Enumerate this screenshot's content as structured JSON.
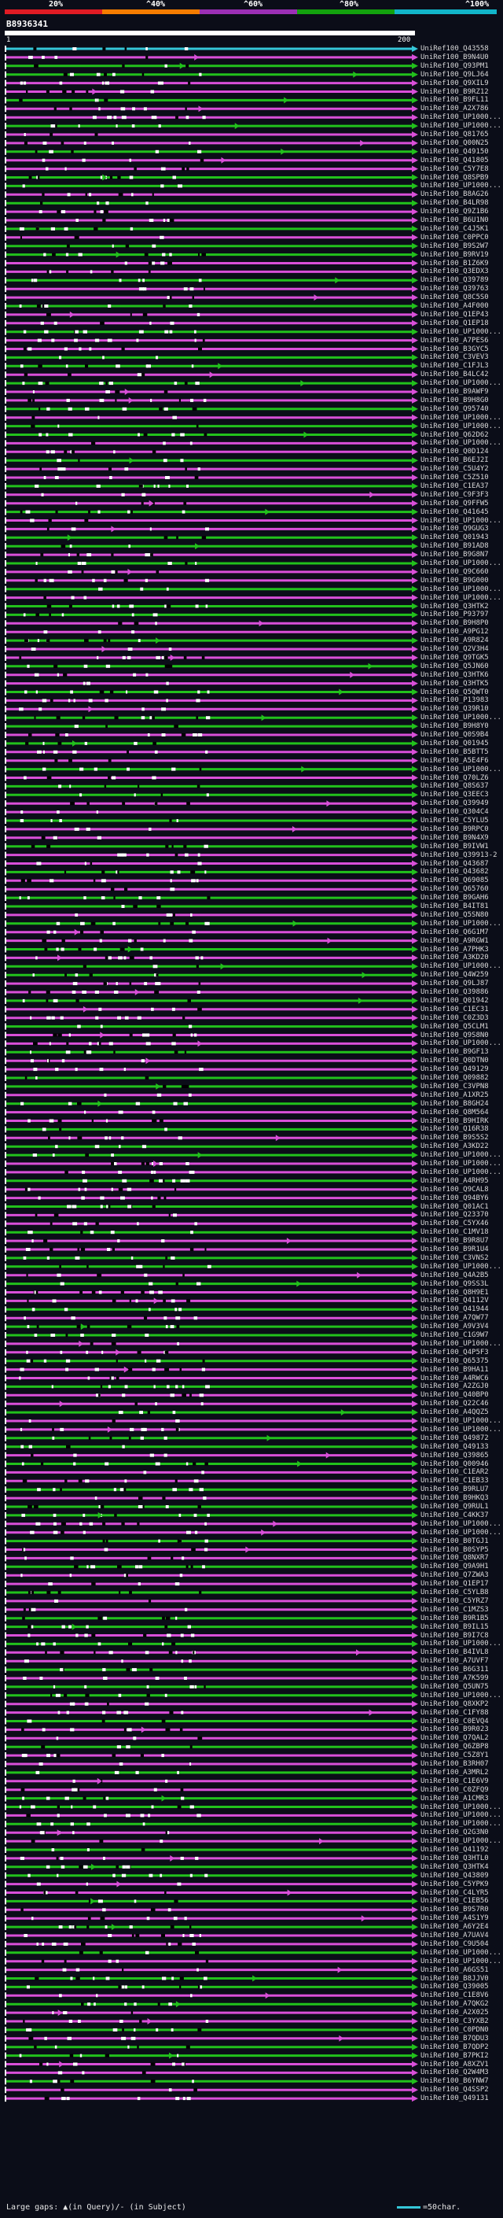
{
  "header": {
    "query_id": "B8936341",
    "start": "1",
    "end": "200",
    "scale_labels": [
      "20%",
      "^40%",
      "^60%",
      "^80%",
      "^100%"
    ],
    "scale_colors": [
      "#e01b24",
      "#f57c00",
      "#9b2fb5",
      "#13a10e",
      "#12b5c9"
    ]
  },
  "colors": {
    "green": "#22c11c",
    "magenta": "#d94fd9",
    "cyan": "#35c6d8",
    "white": "#ffffff",
    "black": "#000000"
  },
  "hits": [
    "UniRef100_Q43558",
    "UniRef100_B9N4U0",
    "UniRef100_Q93PM1",
    "UniRef100_Q9LJ64",
    "UniRef100_Q9XIL9",
    "UniRef100_B9RZ12",
    "UniRef100_B9FL11",
    "UniRef100_A2X786",
    "UniRef100_UP1000...",
    "UniRef100_UP1000...",
    "UniRef100_Q81765",
    "UniRef100_Q00N25",
    "UniRef100_Q49150",
    "UniRef100_Q41805",
    "UniRef100_C5Y7E8",
    "UniRef100_Q8SPB9",
    "UniRef100_UP1000...",
    "UniRef100_B8AG26",
    "UniRef100_B4LR98",
    "UniRef100_Q9Z1B6",
    "UniRef100_B6U1N0",
    "UniRef100_C4J5K1",
    "UniRef100_C0PPC0",
    "UniRef100_B9S2W7",
    "UniRef100_B9RV19",
    "UniRef100_B1Z6K9",
    "UniRef100_Q3EDX3",
    "UniRef100_Q39789",
    "UniRef100_Q39763",
    "UniRef100_Q8C5S0",
    "UniRef100_A4F000",
    "UniRef100_Q1EP43",
    "UniRef100_Q1EP18",
    "UniRef100_UP1000...",
    "UniRef100_A7PES6",
    "UniRef100_B3GYC5",
    "UniRef100_C3VEV3",
    "UniRef100_C1FJL3",
    "UniRef100_B4LC42",
    "UniRef100_UP1000...",
    "UniRef100_B9AWF9",
    "UniRef100_B9H8G0",
    "UniRef100_Q95740",
    "UniRef100_UP1000...",
    "UniRef100_UP1000...",
    "UniRef100_Q62D62",
    "UniRef100_UP1000...",
    "UniRef100_Q0D124",
    "UniRef100_B6EJ2I",
    "UniRef100_C5U4Y2",
    "UniRef100_C5Z510",
    "UniRef100_C1EA37",
    "UniRef100_C9F3F3",
    "UniRef100_Q9FFW5",
    "UniRef100_Q41645",
    "UniRef100_UP1000...",
    "UniRef100_Q9GUG3",
    "UniRef100_Q01943",
    "UniRef100_B91AD8",
    "UniRef100_B9G8N7",
    "UniRef100_UP1000...",
    "UniRef100_Q9C660",
    "UniRef100_B9G000",
    "UniRef100_UP1000...",
    "UniRef100_UP1000...",
    "UniRef100_Q3HTK2",
    "UniRef100_P93797",
    "UniRef100_B9H8P0",
    "UniRef100_A9PG12",
    "UniRef100_A9R824",
    "UniRef100_Q2V3H4",
    "UniRef100_Q9TGK5",
    "UniRef100_Q5JN60",
    "UniRef100_Q3HTK6",
    "UniRef100_Q3HTK5",
    "UniRef100_Q5QWT0",
    "UniRef100_P13983",
    "UniRef100_Q39R10",
    "UniRef100_UP1000...",
    "UniRef100_B9H8Y0",
    "UniRef100_Q0S9B4",
    "UniRef100_Q01945",
    "UniRef100_B5BTT5",
    "UniRef100_A5E4F6",
    "UniRef100_UP1000...",
    "UniRef100_Q70LZ6",
    "UniRef100_Q8S637",
    "UniRef100_Q3EEC3",
    "UniRef100_Q39949",
    "UniRef100_Q304C4",
    "UniRef100_C5YLU5",
    "UniRef100_B9RPC0",
    "UniRef100_B9N4X9",
    "UniRef100_B9IVW1",
    "UniRef100_Q39913-2",
    "UniRef100_Q43687",
    "UniRef100_Q43682",
    "UniRef100_Q69085",
    "UniRef100_Q65760",
    "UniRef100_B9GAH6",
    "UniRef100_B4IT81",
    "UniRef100_Q5SN80",
    "UniRef100_UP1000...",
    "UniRef100_Q6G1M7",
    "UniRef100_A9RGW1",
    "UniRef100_A7PHK3",
    "UniRef100_A3KD20",
    "UniRef100_UP1000...",
    "UniRef100_Q4W259",
    "UniRef100_Q9LJ87",
    "UniRef100_Q39886",
    "UniRef100_Q01942",
    "UniRef100_C1EC31",
    "UniRef100_C0Z3D3",
    "UniRef100_Q5CLM1",
    "UniRef100_Q9S8N0",
    "UniRef100_UP1000...",
    "UniRef100_B9GF13",
    "UniRef100_Q0DTN0",
    "UniRef100_Q49129",
    "UniRef100_Q09882",
    "UniRef100_C3VPN8",
    "UniRef100_A1XR25",
    "UniRef100_B8GH24",
    "UniRef100_Q8M564",
    "UniRef100_B9HIRK",
    "UniRef100_Q16R38",
    "UniRef100_B9S5S2",
    "UniRef100_A3KD22",
    "UniRef100_UP1000...",
    "UniRef100_UP1000...",
    "UniRef100_UP1000...",
    "UniRef100_A4RH95",
    "UniRef100_Q9CAL8",
    "UniRef100_Q94BY6",
    "UniRef100_Q01AC1",
    "UniRef100_Q23370",
    "UniRef100_C5YX46",
    "UniRef100_C1MV18",
    "UniRef100_B9R8U7",
    "UniRef100_B9R1U4",
    "UniRef100_C3VNS2",
    "UniRef100_UP1000...",
    "UniRef100_Q4A2B5",
    "UniRef100_Q9SS3L",
    "UniRef100_Q8H9E1",
    "UniRef100_Q4112V",
    "UniRef100_Q41944",
    "UniRef100_A7QW77",
    "UniRef100_A9V3V4",
    "UniRef100_C1G9W7",
    "UniRef100_UP1000...",
    "UniRef100_Q4P5F3",
    "UniRef100_Q65375",
    "UniRef100_B9HA11",
    "UniRef100_A4RWC6",
    "UniRef100_A2ZGJ0",
    "UniRef100_Q40BP0",
    "UniRef100_Q22C46",
    "UniRef100_A4QQZ5",
    "UniRef100_UP1000...",
    "UniRef100_UP1000...",
    "UniRef100_Q49872",
    "UniRef100_Q49133",
    "UniRef100_Q39865",
    "UniRef100_Q00946",
    "UniRef100_C1EAR2",
    "UniRef100_C1EB33",
    "UniRef100_B9RLU7",
    "UniRef100_B9HKQ3",
    "UniRef100_Q9RUL1",
    "UniRef100_C4KK37",
    "UniRef100_UP1000...",
    "UniRef100_UP1000...",
    "UniRef100_B0TGJ1",
    "UniRef100_B0SYP5",
    "UniRef100_Q8NXR7",
    "UniRef100_Q9A9H1",
    "UniRef100_Q7ZWA3",
    "UniRef100_Q1EP17",
    "UniRef100_C5YLB8",
    "UniRef100_C5YRZ7",
    "UniRef100_C1MZS3",
    "UniRef100_B9R1B5",
    "UniRef100_B9IL15",
    "UniRef100_B9I7C8",
    "UniRef100_UP1000...",
    "UniRef100_B4IVL8",
    "UniRef100_A7UVF7",
    "UniRef100_B6G311",
    "UniRef100_A7K599",
    "UniRef100_Q5UN75",
    "UniRef100_UP1000...",
    "UniRef100_Q8XKP2",
    "UniRef100_C1FY88",
    "UniRef100_C0EVQ4",
    "UniRef100_B9R023",
    "UniRef100_Q7QAL2",
    "UniRef100_Q6ZBP8",
    "UniRef100_C5Z8Y1",
    "UniRef100_B3RH07",
    "UniRef100_A3MRL2",
    "UniRef100_C1E6V9",
    "UniRef100_C0ZFQ9",
    "UniRef100_A1CMR3",
    "UniRef100_UP1000...",
    "UniRef100_UP1000...",
    "UniRef100_UP1000...",
    "UniRef100_Q2G3N0",
    "UniRef100_UP1000...",
    "UniRef100_Q41192",
    "UniRef100_Q3HTL0",
    "UniRef100_Q3HTK4",
    "UniRef100_Q43809",
    "UniRef100_C5YPK9",
    "UniRef100_C4LYR5",
    "UniRef100_C1EB56",
    "UniRef100_B9S7R0",
    "UniRef100_A4S1Y9",
    "UniRef100_A6Y2E4",
    "UniRef100_A7UAV4",
    "UniRef100_C9U504",
    "UniRef100_UP1000...",
    "UniRef100_UP1000...",
    "UniRef100_A6GS51",
    "UniRef100_B8JJV0",
    "UniRef100_Q39005",
    "UniRef100_C1E8V6",
    "UniRef100_A7QKG2",
    "UniRef100_A2X025",
    "UniRef100_C3YXB2",
    "UniRef100_C0PDN0",
    "UniRef100_B7QDU3",
    "UniRef100_B7QDP2",
    "UniRef100_B7PKI2",
    "UniRef100_A8XZV1",
    "UniRef100_Q2W4M3",
    "UniRef100_B6YNW7",
    "UniRef100_Q4SSP2",
    "UniRef100_Q49131"
  ],
  "legend": {
    "left_text": "Large gaps: ▲(in Query)/- (in Subject)",
    "right_text": "=50char."
  }
}
